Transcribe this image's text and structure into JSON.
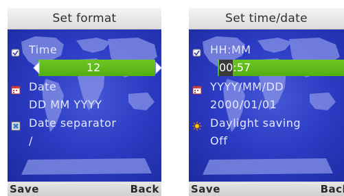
{
  "left_screen": {
    "title": "Set format",
    "rows": [
      {
        "label": "Time",
        "icon": "checkbox-icon"
      },
      {
        "label": "Date",
        "icon": "calendar-icon"
      },
      {
        "label": "Date separator",
        "icon": "separator-icon"
      }
    ],
    "time_value": "12",
    "date_value": "DD MM YYYY",
    "separator_value": "/",
    "softkeys": {
      "left": "Save",
      "right": "Back"
    }
  },
  "right_screen": {
    "title": "Set time/date",
    "rows": [
      {
        "label": "HH:MM",
        "icon": "checkbox-icon"
      },
      {
        "label": "YYYY/MM/DD",
        "icon": "calendar-icon"
      },
      {
        "label": "Daylight saving",
        "icon": "sun-icon"
      }
    ],
    "time_value_caret": "00",
    "time_value_rest": ":57",
    "date_value": "2000/01/01",
    "daylight_value": "Off",
    "softkeys": {
      "left": "Save",
      "right": "Back"
    }
  },
  "colors": {
    "background_blue": "#2c3cc4",
    "selection_green": "#5cb71a",
    "map_land": "#8f9ae8",
    "title_bar": "#e6e6e6"
  }
}
